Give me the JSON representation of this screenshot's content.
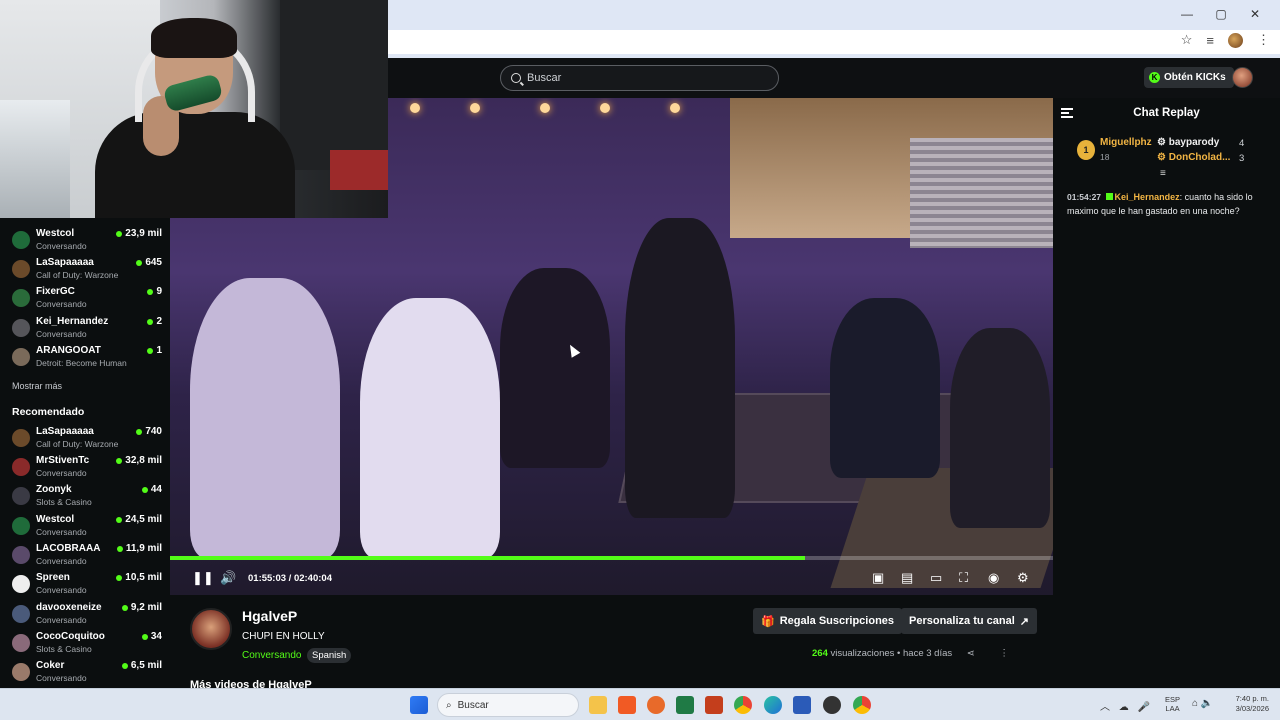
{
  "browser": {
    "window_controls": [
      "—",
      "▢",
      "✕"
    ]
  },
  "topbar": {
    "search_placeholder": "Buscar",
    "kicks_label": "Obtén KICKs"
  },
  "sidebar": {
    "following": [
      {
        "name": "Westcol",
        "category": "Conversando",
        "viewers": "23,9 mil",
        "color": "#1f6b3a"
      },
      {
        "name": "LaSapaaaaa",
        "category": "Call of Duty: Warzone",
        "viewers": "645",
        "color": "#6b4a2a"
      },
      {
        "name": "FixerGC",
        "category": "Conversando",
        "viewers": "9",
        "color": "#2a6b3a"
      },
      {
        "name": "Kei_Hernandez",
        "category": "Conversando",
        "viewers": "2",
        "color": "#55555a"
      },
      {
        "name": "ARANGOOAT",
        "category": "Detroit: Become Human",
        "viewers": "1",
        "color": "#7a6a5a"
      }
    ],
    "show_more": "Mostrar más",
    "recommended_title": "Recomendado",
    "recommended": [
      {
        "name": "LaSapaaaaa",
        "category": "Call of Duty: Warzone",
        "viewers": "740",
        "color": "#6b4a2a"
      },
      {
        "name": "MrStivenTc",
        "category": "Conversando",
        "viewers": "32,8 mil",
        "color": "#8a2a2a"
      },
      {
        "name": "Zoonyk",
        "category": "Slots & Casino",
        "viewers": "44",
        "color": "#3a3a44"
      },
      {
        "name": "Westcol",
        "category": "Conversando",
        "viewers": "24,5 mil",
        "color": "#1f6b3a"
      },
      {
        "name": "LACOBRAAA",
        "category": "Conversando",
        "viewers": "11,9 mil",
        "color": "#5a4a6a"
      },
      {
        "name": "Spreen",
        "category": "Conversando",
        "viewers": "10,5 mil",
        "color": "#eeeeee"
      },
      {
        "name": "davooxeneize",
        "category": "Conversando",
        "viewers": "9,2 mil",
        "color": "#4a5a7a"
      },
      {
        "name": "CocoCoquitoo",
        "category": "Slots & Casino",
        "viewers": "34",
        "color": "#8a6a7a"
      },
      {
        "name": "Coker",
        "category": "Conversando",
        "viewers": "6,5 mil",
        "color": "#9a7a6a"
      }
    ]
  },
  "player": {
    "progress_fraction": 0.719,
    "current_time": "01:55:03",
    "separator": "/",
    "duration": "02:40:04"
  },
  "chat": {
    "title": "Chat Replay",
    "leaderboard": {
      "rank": "1",
      "top_user": "Miguellphz",
      "top_count": "18",
      "second_user": "bayparody",
      "second_count": "4",
      "third_user": "DonCholad...",
      "third_count": "3"
    },
    "message": {
      "time": "01:54:27",
      "user": "Kei_Hernandez",
      "text": "cuanto ha sido lo maximo que le han gastado en una noche?"
    }
  },
  "stream": {
    "streamer": "HgalveP",
    "title": "CHUPI EN HOLLY",
    "category": "Conversando",
    "tag": "Spanish",
    "gift_button": "Regala Suscripciones",
    "customize_button": "Personaliza tu canal",
    "view_count": "264",
    "views_label": "visualizaciones",
    "dot": "•",
    "time_ago": "hace 3 días",
    "more_videos": "Más videos de HgalveP"
  },
  "taskbar": {
    "search_placeholder": "Buscar",
    "lang_1": "ESP",
    "lang_2": "LAA",
    "time": "7:40 p. m.",
    "date": "3/03/2026"
  }
}
